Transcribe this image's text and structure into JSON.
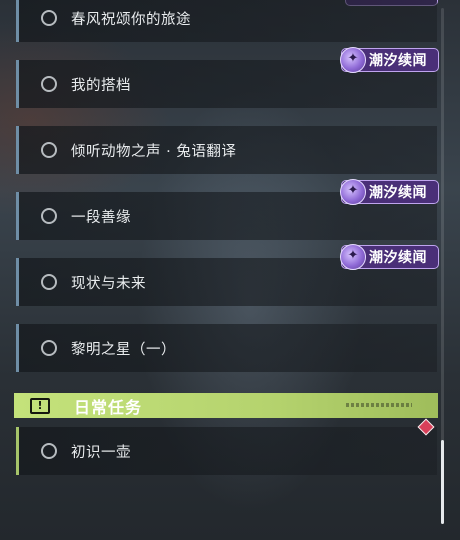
{
  "quests": [
    {
      "title": "春风祝颂你的旅途",
      "badge": null
    },
    {
      "title": "我的搭档",
      "badge": "潮汐续闻"
    },
    {
      "title": "倾听动物之声 · 兔语翻译",
      "badge": null
    },
    {
      "title": "一段善缘",
      "badge": "潮汐续闻"
    },
    {
      "title": "现状与未来",
      "badge": "潮汐续闻"
    },
    {
      "title": "黎明之星（一）",
      "badge": null
    }
  ],
  "daily_section": {
    "title": "日常任务",
    "icon": "exclamation-icon",
    "accent_color": "#c4e27b"
  },
  "daily_quests": [
    {
      "title": "初识一壶"
    }
  ],
  "badge_icon": "tidal-sparkle-icon",
  "badge_color": "#4a2f78",
  "quest_accent_color": "#6f8ea6",
  "marker_color": "#d9405a"
}
